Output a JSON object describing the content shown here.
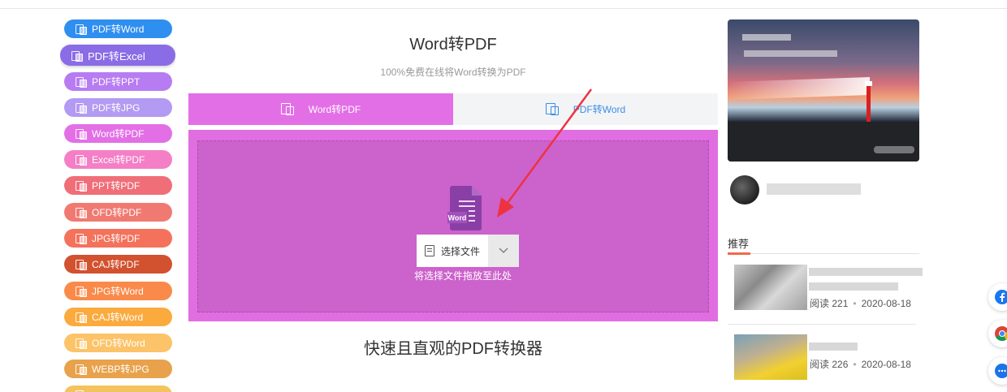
{
  "sidebar": {
    "items": [
      {
        "label": "PDF转Word",
        "color": "#2f8ff0"
      },
      {
        "label": "PDF转Excel",
        "color": "#8a6ce6"
      },
      {
        "label": "PDF转PPT",
        "color": "#b77cf2"
      },
      {
        "label": "PDF转JPG",
        "color": "#b39af2"
      },
      {
        "label": "Word转PDF",
        "color": "#e36fe6"
      },
      {
        "label": "Excel转PDF",
        "color": "#f47fc6"
      },
      {
        "label": "PPT转PDF",
        "color": "#f06e78"
      },
      {
        "label": "OFD转PDF",
        "color": "#f07a72"
      },
      {
        "label": "JPG转PDF",
        "color": "#f4725c"
      },
      {
        "label": "CAJ转PDF",
        "color": "#d2512e"
      },
      {
        "label": "JPG转Word",
        "color": "#fa8a4a"
      },
      {
        "label": "CAJ转Word",
        "color": "#fbaa3e"
      },
      {
        "label": "OFD转Word",
        "color": "#fcc368"
      },
      {
        "label": "WEBP转JPG",
        "color": "#e8a24c"
      },
      {
        "label": "",
        "color": "#f3c45e"
      }
    ]
  },
  "main": {
    "title": "Word转PDF",
    "subtitle": "100%免费在线将Word转换为PDF",
    "tabs": [
      {
        "label": "Word转PDF"
      },
      {
        "label": "PDF转Word"
      }
    ],
    "select_file_label": "选择文件",
    "word_icon_label": "Word",
    "drop_hint": "将选择文件拖放至此处",
    "bottom_title": "快速且直观的PDF转换器"
  },
  "right": {
    "recommend_title": "推荐",
    "articles": [
      {
        "views_label": "阅读",
        "views": "221",
        "date": "2020-08-18"
      },
      {
        "views_label": "阅读",
        "views": "226",
        "date": "2020-08-18"
      }
    ]
  },
  "floating": [
    "facebook-icon",
    "chrome-icon",
    "chat-icon"
  ],
  "colors": {
    "accent": "#e36fe6",
    "upload_bg": "#e06ee0",
    "upload_inner": "#cc62cc",
    "tab_link": "#3a8ee6",
    "arrow": "#ee3340"
  }
}
